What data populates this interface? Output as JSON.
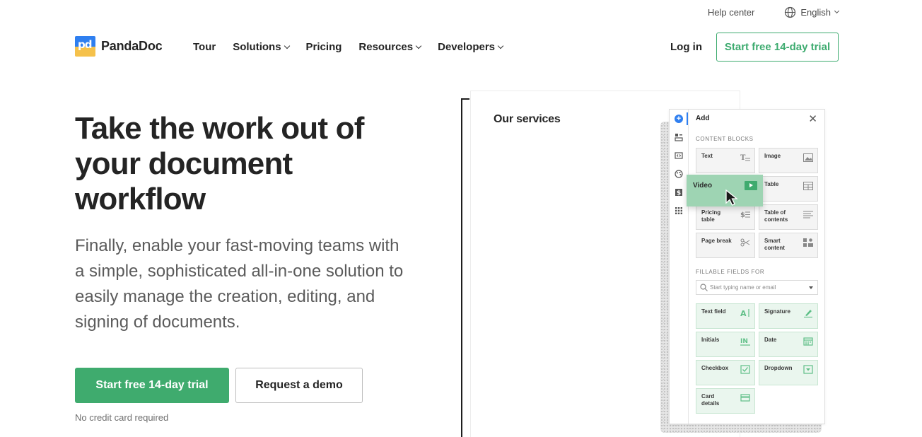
{
  "utility": {
    "help": "Help center",
    "language": "English",
    "icons": {
      "globe": "globe-icon",
      "chevron": "chevron-down-icon"
    }
  },
  "brand": {
    "name": "PandaDoc",
    "mark": "pd"
  },
  "nav": {
    "items": [
      {
        "label": "Tour",
        "has_menu": false
      },
      {
        "label": "Solutions",
        "has_menu": true
      },
      {
        "label": "Pricing",
        "has_menu": false
      },
      {
        "label": "Resources",
        "has_menu": true
      },
      {
        "label": "Developers",
        "has_menu": true
      }
    ],
    "login": "Log in",
    "trial": "Start free 14-day trial"
  },
  "hero": {
    "title": "Take the work out of your document workflow",
    "subtitle": "Finally, enable your fast-moving teams with a simple, sophisticated all-in-one solution to easily manage the creation, editing, and signing of documents.",
    "primary_cta": "Start free 14-day trial",
    "secondary_cta": "Request a demo",
    "note": "No credit card required"
  },
  "illustration": {
    "doc_heading": "Our services",
    "panel": {
      "title": "Add",
      "close": "✕",
      "content_blocks_label": "CONTENT BLOCKS",
      "blocks": [
        {
          "label": "Text",
          "icon": "text-icon"
        },
        {
          "label": "Image",
          "icon": "image-icon"
        },
        {
          "label": "Table",
          "icon": "table-icon"
        },
        {
          "label_line1": "Pricing",
          "label_line2": "table",
          "icon": "pricing-table-icon"
        },
        {
          "label_line1": "Table of",
          "label_line2": "contents",
          "icon": "toc-icon"
        },
        {
          "label": "Page break",
          "icon": "scissors-icon"
        },
        {
          "label_line1": "Smart",
          "label_line2": "content",
          "icon": "smart-content-icon"
        }
      ],
      "dragging": {
        "label": "Video",
        "icon": "video-icon"
      },
      "fields_label": "FILLABLE FIELDS FOR",
      "search_placeholder": "Start typing name or email",
      "fields": [
        {
          "label": "Text field",
          "icon": "text-field-icon"
        },
        {
          "label": "Signature",
          "icon": "pen-icon"
        },
        {
          "label": "Initials",
          "icon": "initials-icon"
        },
        {
          "label": "Date",
          "icon": "calendar-icon"
        },
        {
          "label": "Checkbox",
          "icon": "checkbox-icon"
        },
        {
          "label": "Dropdown",
          "icon": "dropdown-icon"
        },
        {
          "label_line1": "Card",
          "label_line2": "details",
          "icon": "card-icon"
        }
      ]
    }
  },
  "colors": {
    "brand_green": "#3fab6e",
    "brand_blue": "#2f7ff0",
    "brand_yellow": "#f5c14b",
    "text": "#242424"
  }
}
